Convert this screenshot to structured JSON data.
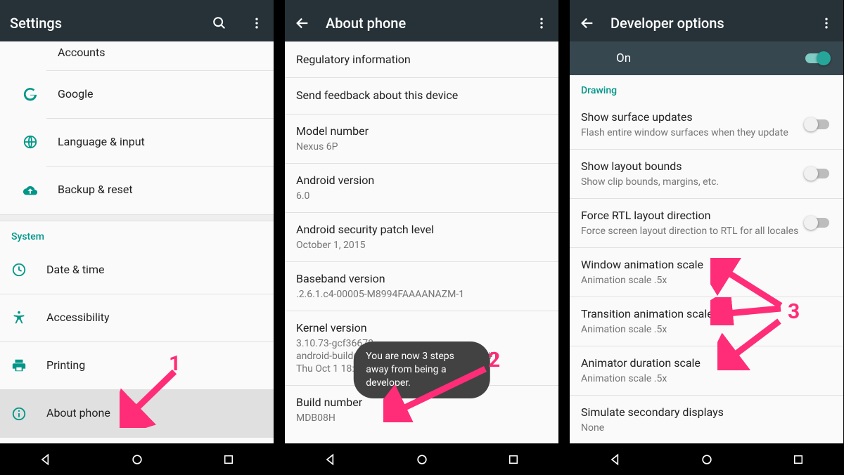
{
  "colors": {
    "accent": "#ff2d78",
    "teal": "#009688"
  },
  "annotations": {
    "one": "1",
    "two": "2",
    "three": "3"
  },
  "panel1": {
    "appbar_title": "Settings",
    "items_top": [
      {
        "label": "Accounts"
      },
      {
        "label": "Google"
      },
      {
        "label": "Language & input"
      },
      {
        "label": "Backup & reset"
      }
    ],
    "section": "System",
    "items_bottom": [
      {
        "label": "Date & time"
      },
      {
        "label": "Accessibility"
      },
      {
        "label": "Printing"
      },
      {
        "label": "About phone"
      }
    ]
  },
  "panel2": {
    "appbar_title": "About phone",
    "items": [
      {
        "primary": "Regulatory information"
      },
      {
        "primary": "Send feedback about this device"
      },
      {
        "primary": "Model number",
        "secondary": "Nexus 6P"
      },
      {
        "primary": "Android version",
        "secondary": "6.0"
      },
      {
        "primary": "Android security patch level",
        "secondary": "October 1, 2015"
      },
      {
        "primary": "Baseband version",
        "secondary": ".2.6.1.c4-00005-M8994FAAAANAZM-1"
      },
      {
        "primary": "Kernel version",
        "secondary": "3.10.73-gcf36678\nandroid-build@vpbs7.mtv.corp.google.com #1\nThu Oct 1 18:25:24 UTC 2015"
      },
      {
        "primary": "Build number",
        "secondary": "MDB08H"
      }
    ],
    "toast": "You are now 3 steps away from being a developer."
  },
  "panel3": {
    "appbar_title": "Developer options",
    "master_label": "On",
    "section": "Drawing",
    "items": [
      {
        "primary": "Show surface updates",
        "secondary": "Flash entire window surfaces when they update",
        "toggle": false
      },
      {
        "primary": "Show layout bounds",
        "secondary": "Show clip bounds, margins, etc.",
        "toggle": false
      },
      {
        "primary": "Force RTL layout direction",
        "secondary": "Force screen layout direction to RTL for all locales",
        "toggle": false
      },
      {
        "primary": "Window animation scale",
        "secondary": "Animation scale .5x"
      },
      {
        "primary": "Transition animation scale",
        "secondary": "Animation scale .5x"
      },
      {
        "primary": "Animator duration scale",
        "secondary": "Animation scale .5x"
      },
      {
        "primary": "Simulate secondary displays",
        "secondary": "None"
      }
    ]
  }
}
